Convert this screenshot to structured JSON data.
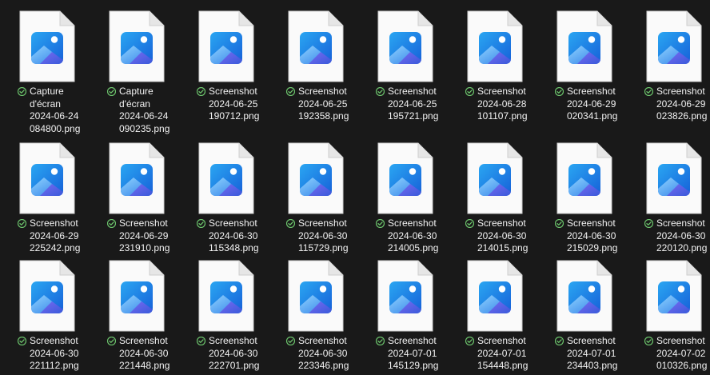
{
  "view": "large-icons",
  "icon": "image-file-icon",
  "status_icon": "synced-check-icon",
  "colors": {
    "background": "#191919",
    "text": "#f2f2f2",
    "sync_green": "#6cc36c",
    "photo_blue": "#1e74e6"
  },
  "files": [
    {
      "line1": "Capture",
      "line2": "d'écran",
      "line3": "2024-06-24",
      "line4": "084800.png"
    },
    {
      "line1": "Capture",
      "line2": "d'écran",
      "line3": "2024-06-24",
      "line4": "090235.png"
    },
    {
      "line1": "Screenshot",
      "line2": "2024-06-25",
      "line3": "190712.png",
      "line4": ""
    },
    {
      "line1": "Screenshot",
      "line2": "2024-06-25",
      "line3": "192358.png",
      "line4": ""
    },
    {
      "line1": "Screenshot",
      "line2": "2024-06-25",
      "line3": "195721.png",
      "line4": ""
    },
    {
      "line1": "Screenshot",
      "line2": "2024-06-28",
      "line3": "101107.png",
      "line4": ""
    },
    {
      "line1": "Screenshot",
      "line2": "2024-06-29",
      "line3": "020341.png",
      "line4": ""
    },
    {
      "line1": "Screenshot",
      "line2": "2024-06-29",
      "line3": "023826.png",
      "line4": ""
    },
    {
      "line1": "Screenshot",
      "line2": "2024-06-29",
      "line3": "225242.png",
      "line4": ""
    },
    {
      "line1": "Screenshot",
      "line2": "2024-06-29",
      "line3": "231910.png",
      "line4": ""
    },
    {
      "line1": "Screenshot",
      "line2": "2024-06-30",
      "line3": "115348.png",
      "line4": ""
    },
    {
      "line1": "Screenshot",
      "line2": "2024-06-30",
      "line3": "115729.png",
      "line4": ""
    },
    {
      "line1": "Screenshot",
      "line2": "2024-06-30",
      "line3": "214005.png",
      "line4": ""
    },
    {
      "line1": "Screenshot",
      "line2": "2024-06-30",
      "line3": "214015.png",
      "line4": ""
    },
    {
      "line1": "Screenshot",
      "line2": "2024-06-30",
      "line3": "215029.png",
      "line4": ""
    },
    {
      "line1": "Screenshot",
      "line2": "2024-06-30",
      "line3": "220120.png",
      "line4": ""
    },
    {
      "line1": "Screenshot",
      "line2": "2024-06-30",
      "line3": "221112.png",
      "line4": ""
    },
    {
      "line1": "Screenshot",
      "line2": "2024-06-30",
      "line3": "221448.png",
      "line4": ""
    },
    {
      "line1": "Screenshot",
      "line2": "2024-06-30",
      "line3": "222701.png",
      "line4": ""
    },
    {
      "line1": "Screenshot",
      "line2": "2024-06-30",
      "line3": "223346.png",
      "line4": ""
    },
    {
      "line1": "Screenshot",
      "line2": "2024-07-01",
      "line3": "145129.png",
      "line4": ""
    },
    {
      "line1": "Screenshot",
      "line2": "2024-07-01",
      "line3": "154448.png",
      "line4": ""
    },
    {
      "line1": "Screenshot",
      "line2": "2024-07-01",
      "line3": "234403.png",
      "line4": ""
    },
    {
      "line1": "Screenshot",
      "line2": "2024-07-02",
      "line3": "010326.png",
      "line4": ""
    }
  ]
}
